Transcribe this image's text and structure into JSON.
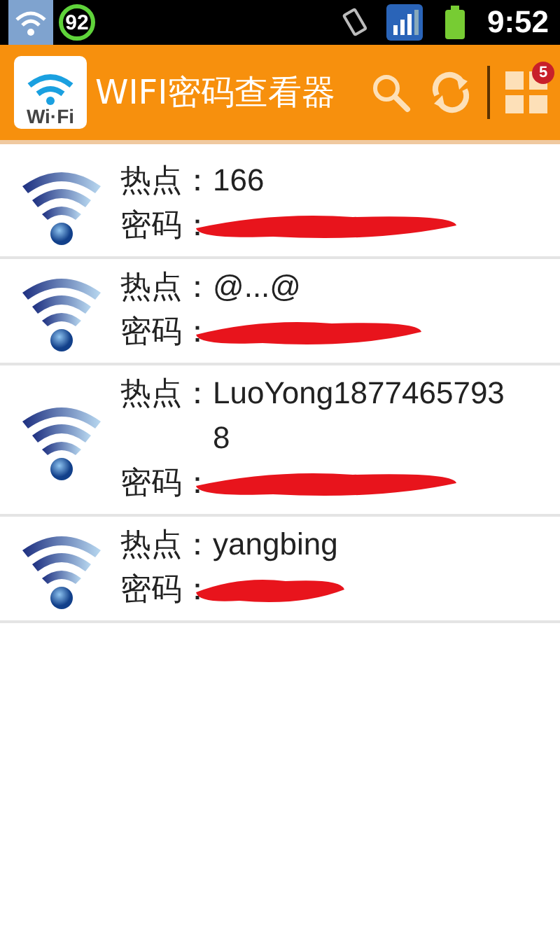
{
  "status_bar": {
    "battery_percent": "92",
    "time": "9:52"
  },
  "app_bar": {
    "title": "WIFI密码查看器",
    "logo_text": "Wi·Fi",
    "notification_count": "5"
  },
  "networks": [
    {
      "hotspot_label": "热点：",
      "hotspot": "166",
      "password_label": "密码：",
      "redacted": true
    },
    {
      "hotspot_label": "热点：",
      "hotspot": "@...@",
      "password_label": "密码：",
      "redacted": true
    },
    {
      "hotspot_label": "热点：",
      "hotspot": "LuoYong18774657938",
      "password_label": "密码：",
      "redacted": true
    },
    {
      "hotspot_label": "热点：",
      "hotspot": "yangbing",
      "password_label": "密码：",
      "redacted": true
    }
  ]
}
